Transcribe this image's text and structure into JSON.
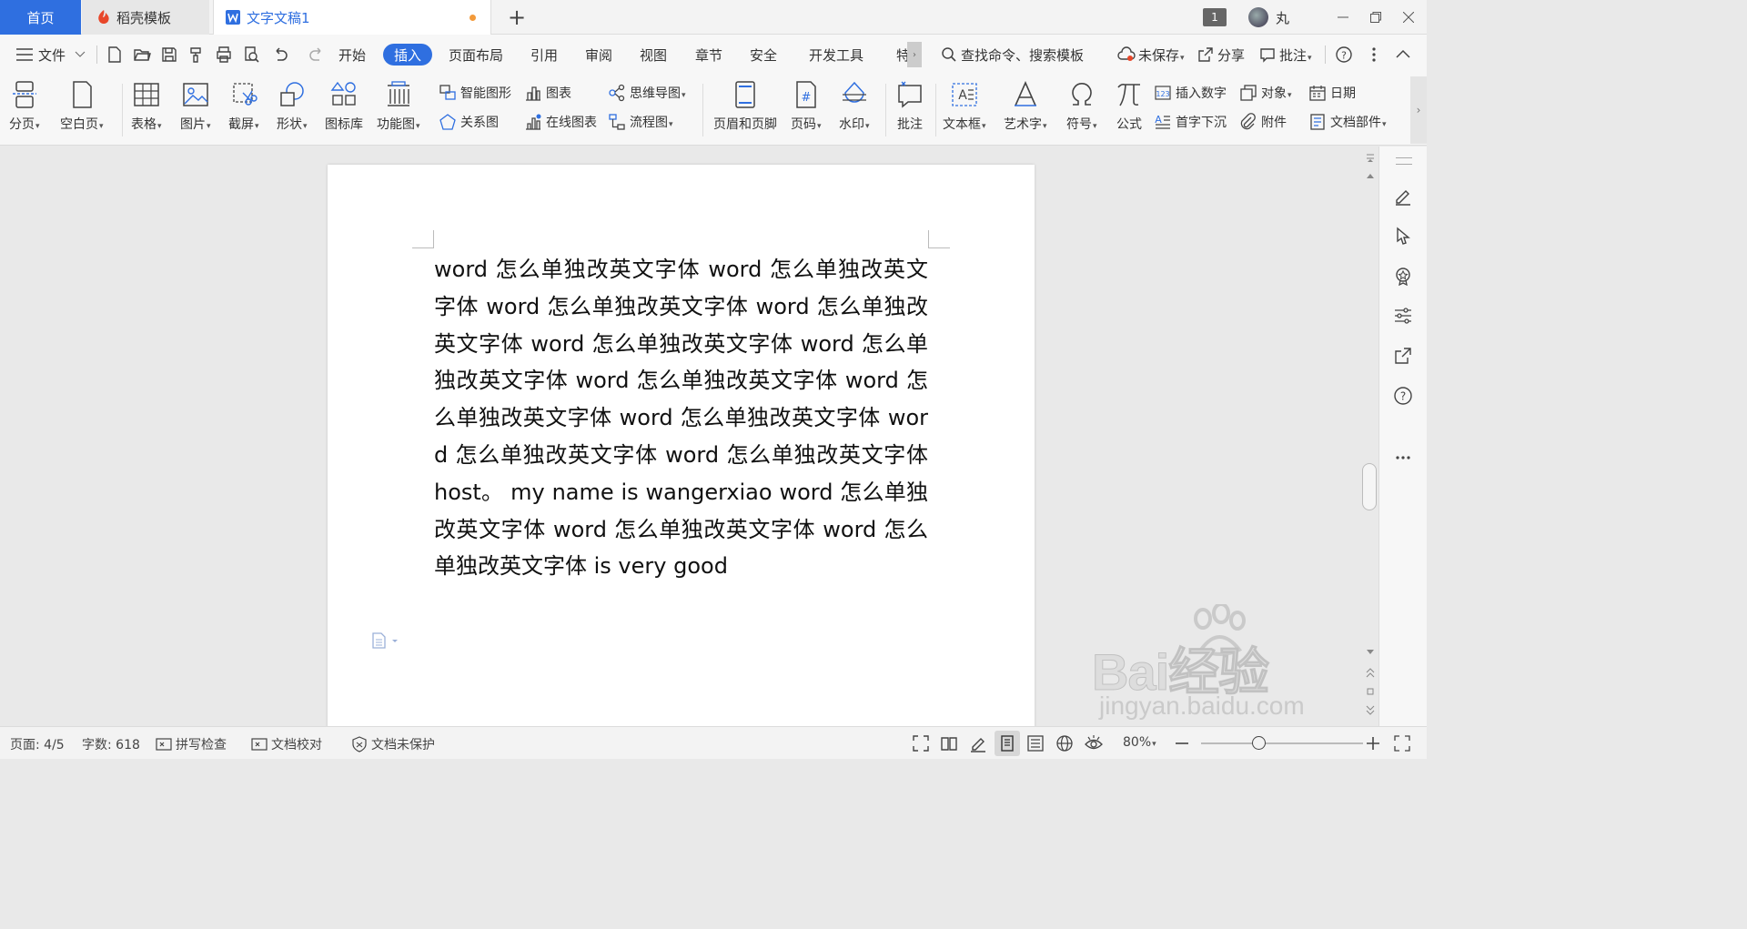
{
  "titlebar": {
    "tabs": [
      {
        "label": "首页"
      },
      {
        "label": "稻壳模板"
      },
      {
        "label": "文字文稿1"
      }
    ],
    "window_count": "1",
    "username": "丸"
  },
  "menu": {
    "file": "文件",
    "items": [
      "开始",
      "插入",
      "页面布局",
      "引用",
      "审阅",
      "视图",
      "章节",
      "安全",
      "开发工具",
      "特"
    ],
    "active": "插入",
    "search_placeholder": "查找命令、搜索模板",
    "unsaved": "未保存",
    "share": "分享",
    "comment": "批注"
  },
  "ribbon": {
    "page_break": "分页",
    "blank_page": "空白页",
    "table": "表格",
    "picture": "图片",
    "screenshot": "截屏",
    "shapes": "形状",
    "icon_library": "图标库",
    "function_chart": "功能图",
    "smart_art": "智能图形",
    "chart": "图表",
    "mind_map": "思维导图",
    "relation_chart": "关系图",
    "online_chart": "在线图表",
    "flowchart": "流程图",
    "header_footer": "页眉和页脚",
    "page_number": "页码",
    "watermark": "水印",
    "comment": "批注",
    "text_box": "文本框",
    "word_art": "艺术字",
    "symbol": "符号",
    "formula": "公式",
    "insert_number": "插入数字",
    "object": "对象",
    "date": "日期",
    "drop_cap": "首字下沉",
    "attachment": "附件",
    "doc_parts": "文档部件"
  },
  "document": {
    "body": "word 怎么单独改英文字体 word 怎么单独改英文字体 word 怎么单独改英文字体 word 怎么单独改英文字体 word 怎么单独改英文字体 word 怎么单独改英文字体 word 怎么单独改英文字体 word 怎么单独改英文字体 word 怎么单独改英文字体 word 怎么单独改英文字体 word 怎么单独改英文字体 host。 my name is wangerxiao word 怎么单独改英文字体 word 怎么单独改英文字体 word 怎么单独改英文字体 is very good"
  },
  "status": {
    "page": "页面: 4/5",
    "word_count": "字数: 618",
    "spell_check": "拼写检查",
    "doc_proof": "文档校对",
    "doc_protect": "文档未保护",
    "zoom": "80%"
  },
  "watermark": {
    "logo": "Bai经验",
    "url": "jingyan.baidu.com"
  },
  "colors": {
    "accent": "#2f6fe0",
    "unsaved_dot": "#f39a3a"
  }
}
